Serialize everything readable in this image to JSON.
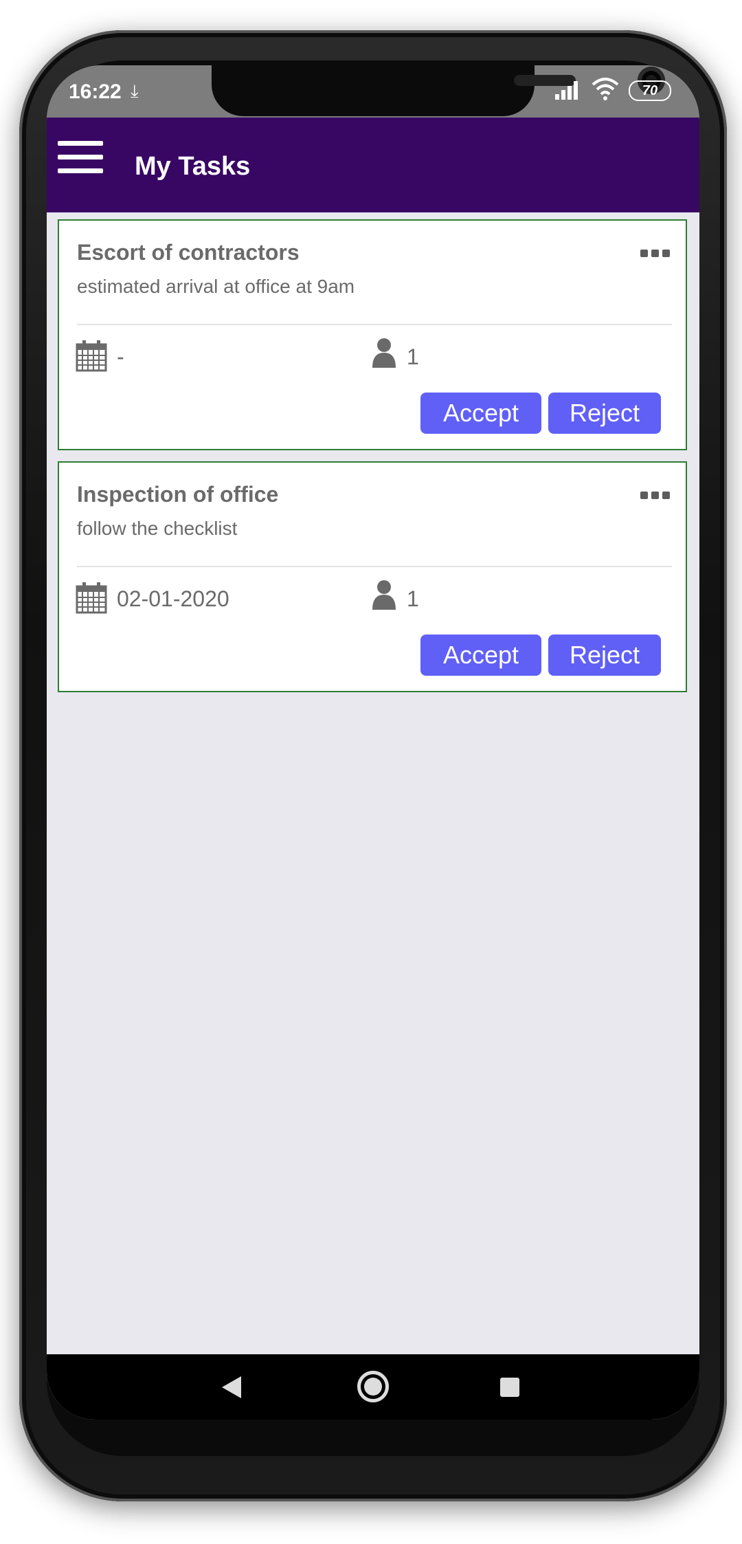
{
  "status_bar": {
    "time": "16:22",
    "download_icon": "download-icon",
    "battery": "70",
    "icons": [
      "signal-icon",
      "wifi-icon",
      "battery-icon"
    ]
  },
  "app_bar": {
    "title": "My Tasks",
    "menu_icon": "hamburger-menu-icon",
    "background": "#380763"
  },
  "tasks": [
    {
      "title": "Escort of contractors",
      "description": "estimated arrival at office at 9am",
      "date": "-",
      "assignees": "1",
      "accept_label": "Accept",
      "reject_label": "Reject"
    },
    {
      "title": "Inspection of office",
      "description": "follow the checklist",
      "date": "02-01-2020",
      "assignees": "1",
      "accept_label": "Accept",
      "reject_label": "Reject"
    }
  ],
  "colors": {
    "accent_button": "#6060f7",
    "card_border": "#2e7d32",
    "screen_background": "#e8e8ee"
  },
  "nav_bar": {
    "icons": [
      "back-icon",
      "home-icon",
      "recents-icon"
    ]
  }
}
